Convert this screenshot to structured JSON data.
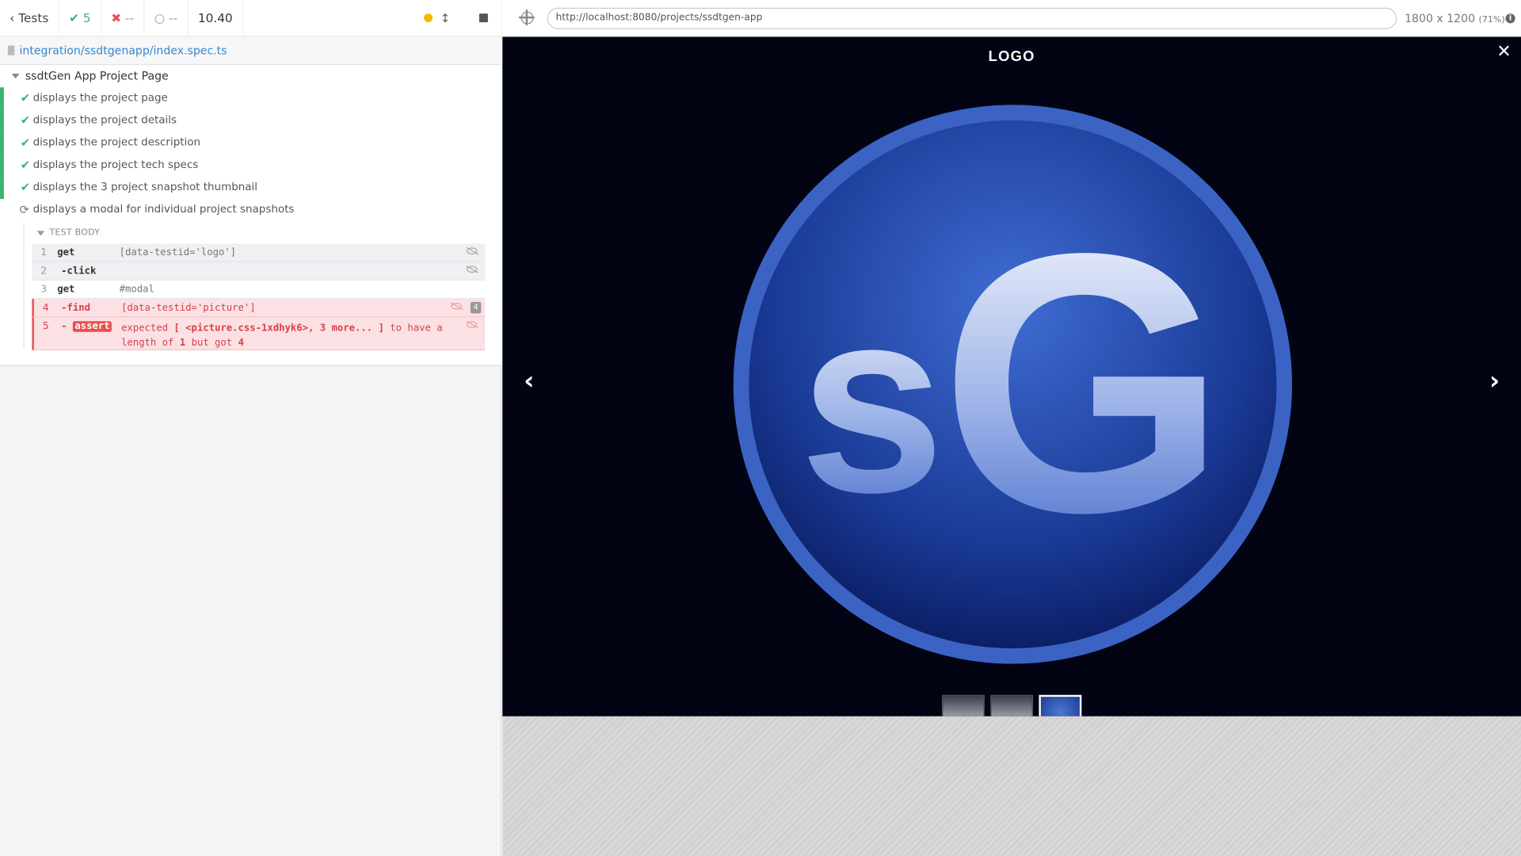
{
  "reporter": {
    "tests_button": "Tests",
    "passed": "5",
    "failed": "--",
    "pending": "--",
    "duration": "10.40",
    "spec_path": "integration/ssdtgenapp/index.spec.ts",
    "suite_title": "ssdtGen App Project Page",
    "tests": [
      {
        "label": "displays the project page",
        "state": "passed"
      },
      {
        "label": "displays the project details",
        "state": "passed"
      },
      {
        "label": "displays the project description",
        "state": "passed"
      },
      {
        "label": "displays the project tech specs",
        "state": "passed"
      },
      {
        "label": "displays the 3 project snapshot thumbnail",
        "state": "passed"
      },
      {
        "label": "displays a modal for individual project snapshots",
        "state": "running"
      }
    ],
    "test_body_label": "TEST BODY",
    "commands": [
      {
        "num": "1",
        "name": "get",
        "msg": "[data-testid='logo']"
      },
      {
        "num": "2",
        "name": "-click",
        "msg": ""
      },
      {
        "num": "3",
        "name": "get",
        "msg": "#modal"
      },
      {
        "num": "4",
        "name": "-find",
        "msg": "[data-testid='picture']",
        "badge": "4"
      },
      {
        "num": "5",
        "name": "-",
        "tag": "assert",
        "msg_a": "expected",
        "msg_b": "[ <picture.css-1xdhyk6>, 3 more... ]",
        "msg_c": "to have a",
        "msg_d": "length of",
        "msg_e": "1",
        "msg_f": "but got",
        "msg_g": "4"
      }
    ]
  },
  "aut": {
    "url": "http://localhost:8080/projects/ssdtgen-app",
    "viewport": "1800 x 1200",
    "zoom": "(71%)",
    "modal_title": "LOGO",
    "close_glyph": "✕",
    "prev_glyph": "‹",
    "next_glyph": "›",
    "thumbnail_count": 3,
    "active_thumbnail": 3
  },
  "colors": {
    "passed": "#3cb371",
    "failed": "#e94f4f",
    "link": "#3386d4",
    "modal_bg": "#020413",
    "logo_blue": "#2f55b8"
  }
}
